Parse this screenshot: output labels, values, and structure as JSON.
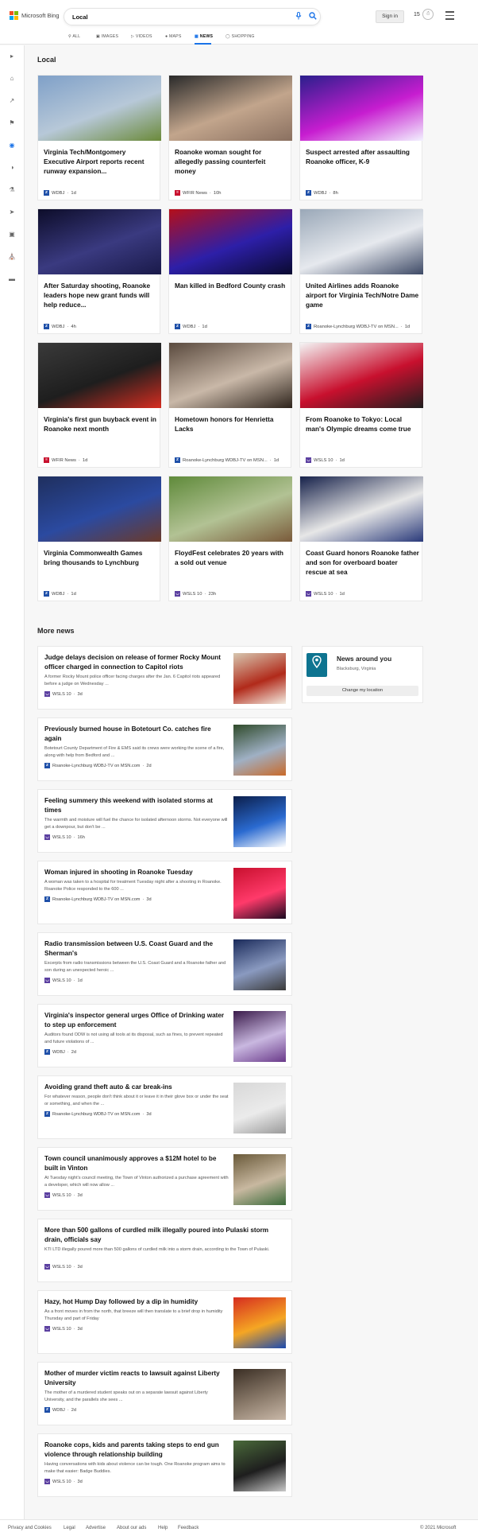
{
  "header": {
    "brand": "Microsoft Bing",
    "search_value": "Local",
    "signin_label": "Sign in",
    "rewards_count": "15"
  },
  "tabs": [
    {
      "icon": "search-icon",
      "label": "ALL"
    },
    {
      "icon": "image-icon",
      "label": "IMAGES"
    },
    {
      "icon": "video-icon",
      "label": "VIDEOS"
    },
    {
      "icon": "map-pin-icon",
      "label": "MAPS"
    },
    {
      "icon": "news-icon",
      "label": "NEWS",
      "active": true
    },
    {
      "icon": "tag-icon",
      "label": "SHOPPING"
    }
  ],
  "sidebar_icons": [
    "expand-icon",
    "home-icon",
    "trending-icon",
    "flag-icon",
    "location-icon",
    "globe-icon",
    "science-icon",
    "rocket-icon",
    "entertainment-icon",
    "politics-icon",
    "money-icon"
  ],
  "local": {
    "heading": "Local",
    "cards": [
      {
        "title": "Virginia Tech/Montgomery Executive Airport reports recent runway expansion...",
        "source": "WDBJ",
        "age": "1d",
        "logo": "wdbj",
        "img": [
          "#7fa0c8",
          "#b7c8d8",
          "#6b8a3a"
        ]
      },
      {
        "title": "Roanoke woman sought for allegedly passing counterfeit money",
        "source": "WFIR News",
        "age": "10h",
        "logo": "wfir",
        "img": [
          "#2a2a2a",
          "#c2a58c",
          "#8a7060"
        ]
      },
      {
        "title": "Suspect arrested after assaulting Roanoke officer, K-9",
        "source": "WDBJ",
        "age": "8h",
        "logo": "wdbj",
        "img": [
          "#2a1f8c",
          "#c71dd0",
          "#f2f2ff"
        ]
      },
      {
        "title": "After Saturday shooting, Roanoke leaders hope new grant funds will help reduce...",
        "source": "WDBJ",
        "age": "4h",
        "logo": "wdbj",
        "img": [
          "#0d0d2a",
          "#3a3a80",
          "#1a1a4a"
        ]
      },
      {
        "title": "Man killed in Bedford County crash",
        "source": "WDBJ",
        "age": "1d",
        "logo": "wdbj",
        "img": [
          "#b50f1a",
          "#2d1fa8",
          "#0a0a30"
        ]
      },
      {
        "title": "United Airlines adds Roanoke airport for Virginia Tech/Notre Dame game",
        "source": "Roanoke-Lynchburg WDBJ-TV on MSN...",
        "age": "1d",
        "logo": "wdbj",
        "img": [
          "#9aa8b8",
          "#e6e9ee",
          "#3e4a66"
        ]
      },
      {
        "title": "Virginia's first gun buyback event in Roanoke next month",
        "source": "WFIR News",
        "age": "1d",
        "logo": "wfir",
        "img": [
          "#3a3a3a",
          "#1e1e1e",
          "#d62d20"
        ]
      },
      {
        "title": "Hometown honors for Henrietta Lacks",
        "source": "Roanoke-Lynchburg WDBJ-TV on MSN...",
        "age": "1d",
        "logo": "wdbj",
        "img": [
          "#5a4a3e",
          "#c9b8a8",
          "#2e241c"
        ]
      },
      {
        "title": "From Roanoke to Tokyo: Local man's Olympic dreams come true",
        "source": "WSLS 10",
        "age": "1d",
        "logo": "wsls",
        "img": [
          "#f4f4f4",
          "#c8102e",
          "#1e1e1e"
        ]
      },
      {
        "title": "Virginia Commonwealth Games bring thousands to Lynchburg",
        "source": "WDBJ",
        "age": "1d",
        "logo": "wdbj",
        "img": [
          "#1f2f5e",
          "#2b4aa0",
          "#6b3a2a"
        ]
      },
      {
        "title": "FloydFest celebrates 20 years with a sold out venue",
        "source": "WSLS 10",
        "age": "23h",
        "logo": "wsls",
        "img": [
          "#5f8a3a",
          "#b2c294",
          "#7a5a3a"
        ]
      },
      {
        "title": "Coast Guard honors Roanoke father and son for overboard boater rescue at sea",
        "source": "WSLS 10",
        "age": "1d",
        "logo": "wsls",
        "img": [
          "#16214a",
          "#e7e7e7",
          "#2a3a7a"
        ]
      }
    ]
  },
  "more": {
    "heading": "More news",
    "items": [
      {
        "title": "Judge delays decision on release of former Rocky Mount officer charged in connection to Capitol riots",
        "snippet": "A former Rocky Mount police officer facing charges after the Jan. 6 Capitol riots appeared before a judge on Wednesday ...",
        "source": "WSLS 10",
        "age": "3d",
        "logo": "wsls",
        "img": [
          "#d7c7b0",
          "#b12a1a",
          "#f4ede2"
        ]
      },
      {
        "title": "Previously burned house in Botetourt Co. catches fire again",
        "snippet": "Botetourt County Department of Fire & EMS said its crews were working the scene of a fire, along with help from Bedford and ...",
        "source": "Roanoke-Lynchburg WDBJ-TV on MSN.com",
        "age": "2d",
        "logo": "wdbj",
        "img": [
          "#2f4a2a",
          "#9fb0c4",
          "#c96a2a"
        ]
      },
      {
        "title": "Feeling summery this weekend with isolated storms at times",
        "snippet": "The warmth and moisture will fuel the chance for isolated afternoon storms. Not everyone will get a downpour, but don't be ...",
        "source": "WSLS 10",
        "age": "16h",
        "logo": "wsls",
        "img": [
          "#0b1e4a",
          "#2a6ad0",
          "#ffffff"
        ]
      },
      {
        "title": "Woman injured in shooting in Roanoke Tuesday",
        "snippet": "A woman was taken to a hospital for treatment Tuesday night after a shooting in Roanoke. Roanoke Police responded to the 600 ...",
        "source": "Roanoke-Lynchburg WDBJ-TV on MSN.com",
        "age": "3d",
        "logo": "wdbj",
        "img": [
          "#c8102e",
          "#ff3a6a",
          "#1a0a20"
        ]
      },
      {
        "title": "Radio transmission between U.S. Coast Guard and the Sherman's",
        "snippet": "Excerpts from radio transmissions between the U.S. Coast Guard and a Roanoke father and son during an unexpected heroic ...",
        "source": "WSLS 10",
        "age": "1d",
        "logo": "wsls",
        "img": [
          "#1a2a5a",
          "#8a9ac0",
          "#3a3a3a"
        ]
      },
      {
        "title": "Virginia's inspector general urges Office of Drinking water to step up enforcement",
        "snippet": "Auditors found ODW is not using all tools at its disposal, such as fines, to prevent repeated and future violations of ...",
        "source": "WDBJ",
        "age": "2d",
        "logo": "wdbj",
        "img": [
          "#3a1a4a",
          "#c9b8e0",
          "#6a3a8a"
        ]
      },
      {
        "title": "Avoiding grand theft auto & car break-ins",
        "snippet": "For whatever reason, people don't think about it or leave it in their glove box or under the seat or something, and when the ...",
        "source": "Roanoke-Lynchburg WDBJ-TV on MSN.com",
        "age": "3d",
        "logo": "wdbj",
        "img": [
          "#d8d8d8",
          "#ebebeb",
          "#9a9a9a"
        ]
      },
      {
        "title": "Town council unanimously approves a $12M hotel to be built in Vinton",
        "snippet": "At Tuesday night's council meeting, the Town of Vinton authorized a purchase agreement with a developer, which will now allow ...",
        "source": "WSLS 10",
        "age": "3d",
        "logo": "wsls",
        "img": [
          "#6a5a3a",
          "#c8b8a0",
          "#3a6a3a"
        ]
      },
      {
        "title": "More than 500 gallons of curdled milk illegally poured into Pulaski storm drain, officials say",
        "snippet": "KTI LTD illegally poured more than 500 gallons of curdled milk into a storm drain, according to the Town of Pulaski.",
        "source": "WSLS 10",
        "age": "3d",
        "logo": "wsls",
        "img": null
      },
      {
        "title": "Hazy, hot Hump Day followed by a dip in humidity",
        "snippet": "As a front moves in from the north, that breeze will then translate to a brief drop in humidity Thursday and part of Friday",
        "source": "WSLS 10",
        "age": "3d",
        "logo": "wsls",
        "img": [
          "#d62d20",
          "#f5a623",
          "#1a4ab0"
        ]
      },
      {
        "title": "Mother of murder victim reacts to lawsuit against Liberty University",
        "snippet": "The mother of a murdered student speaks out on a separate lawsuit against Liberty University, and the parallels she sees ...",
        "source": "WDBJ",
        "age": "2d",
        "logo": "wdbj",
        "img": [
          "#3a2e24",
          "#8a7a6a",
          "#c9b8a8"
        ]
      },
      {
        "title": "Roanoke cops, kids and parents taking steps to end gun violence through relationship building",
        "snippet": "Having conversations with kids about violence can be tough. One Roanoke program aims to make that easier: Badge Buddies.",
        "source": "WSLS 10",
        "age": "3d",
        "logo": "wsls",
        "img": [
          "#4a6a3a",
          "#1e1e1e",
          "#c9c9c9"
        ]
      }
    ]
  },
  "news_around_you": {
    "title": "News around you",
    "location": "Blacksburg, Virginia",
    "button": "Change my location"
  },
  "footer": {
    "links": [
      "Privacy and Cookies",
      "Legal",
      "Advertise",
      "About our ads",
      "Help",
      "Feedback"
    ],
    "copyright": "© 2021 Microsoft"
  },
  "colors": {
    "accent": "#1a73e8",
    "wdbj": "#1e4fa8",
    "wfir": "#c8102e",
    "wsls": "#5b3fa0",
    "pin": "#0e7490"
  }
}
